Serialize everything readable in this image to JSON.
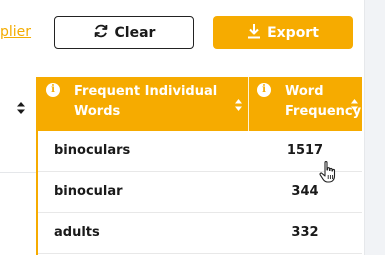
{
  "toolbar": {
    "applier_link": "plier",
    "clear_label": "Clear",
    "clear_icon": "refresh-icon",
    "export_label": "Export",
    "export_icon": "download-icon"
  },
  "table": {
    "columns": [
      {
        "label_line1": "Frequent Individual",
        "label_line2": "Words",
        "icon": "info-icon",
        "sort_icon": "sort-icon"
      },
      {
        "label_line1": "Word",
        "label_line2": "Frequency",
        "icon": "info-icon",
        "sort_icon": "sort-icon"
      }
    ],
    "rows": [
      {
        "word": "binoculars",
        "frequency": "1517"
      },
      {
        "word": "binocular",
        "frequency": "344"
      },
      {
        "word": "adults",
        "frequency": "332"
      }
    ]
  },
  "colors": {
    "accent": "#f6ab00",
    "text": "#1a1a1a",
    "header_text": "#ffffff"
  }
}
